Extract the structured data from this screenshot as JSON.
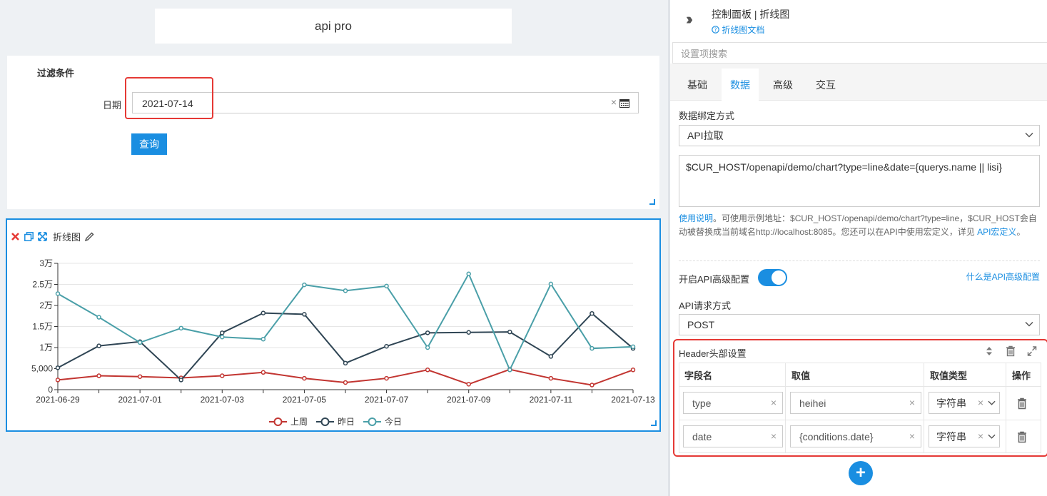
{
  "canvas": {
    "title": "api pro",
    "filter": {
      "title": "过滤条件",
      "date_label": "日期",
      "date_value": "2021-07-14",
      "clear_glyph": "×",
      "query_label": "查询"
    },
    "chart": {
      "toolbar_label": "折线图",
      "toolbar_icons": [
        "close-icon",
        "copy-icon",
        "expand-icon",
        "edit-icon"
      ]
    }
  },
  "chart_data": {
    "type": "line",
    "x": [
      "2021-06-29",
      "2021-06-30",
      "2021-07-01",
      "2021-07-02",
      "2021-07-03",
      "2021-07-04",
      "2021-07-05",
      "2021-07-06",
      "2021-07-07",
      "2021-07-08",
      "2021-07-09",
      "2021-07-10",
      "2021-07-11",
      "2021-07-12",
      "2021-07-13"
    ],
    "x_tick_labels": [
      "2021-06-29",
      "2021-07-01",
      "2021-07-03",
      "2021-07-05",
      "2021-07-07",
      "2021-07-09",
      "2021-07-11",
      "2021-07-13"
    ],
    "y_tick_values": [
      0,
      5000,
      10000,
      15000,
      20000,
      25000,
      30000
    ],
    "y_tick_labels": [
      "0",
      "5,000",
      "1万",
      "1.5万",
      "2万",
      "2.5万",
      "3万"
    ],
    "ylim": [
      0,
      30000
    ],
    "grid": "horizontal",
    "legend_position": "bottom-center",
    "series": [
      {
        "name": "上周",
        "color": "#c23531",
        "values": [
          2300,
          3300,
          3100,
          2800,
          3300,
          4100,
          2700,
          1700,
          2700,
          4700,
          1300,
          4800,
          2700,
          1100,
          4700
        ]
      },
      {
        "name": "昨日",
        "color": "#2f4554",
        "values": [
          5200,
          10400,
          11400,
          2300,
          13500,
          18200,
          17900,
          6300,
          10300,
          13500,
          13600,
          13700,
          7900,
          18100,
          9800
        ]
      },
      {
        "name": "今日",
        "color": "#4a9fa8",
        "values": [
          22800,
          17200,
          11200,
          14600,
          12500,
          12000,
          24900,
          23500,
          24600,
          10000,
          27500,
          4700,
          25100,
          9800,
          10200
        ]
      }
    ]
  },
  "panel": {
    "title": "控制面板 | 折线图",
    "doc_link": "折线图文档",
    "search_placeholder": "设置项搜索",
    "tabs": [
      "基础",
      "数据",
      "高级",
      "交互"
    ],
    "active_tab": "数据",
    "bind_label": "数据绑定方式",
    "bind_value": "API拉取",
    "api_url": "$CUR_HOST/openapi/demo/chart?type=line&date={querys.name || lisi}",
    "help_link": "使用说明",
    "help_text": "。可使用示例地址：$CUR_HOST/openapi/demo/chart?type=line，$CUR_HOST会自动被替换成当前域名http://localhost:8085。您还可以在API中使用宏定义，详见 ",
    "help_link2": "API宏定义",
    "help_end": "。",
    "advanced_label": "开启API高级配置",
    "advanced_on": true,
    "advanced_link": "什么是API高级配置",
    "method_label": "API请求方式",
    "method_value": "POST",
    "header_title": "Header头部设置",
    "header_columns": [
      "字段名",
      "取值",
      "取值类型",
      "操作"
    ],
    "header_rows": [
      {
        "name": "type",
        "value": "heihei",
        "type": "字符串"
      },
      {
        "name": "date",
        "value": "{conditions.date}",
        "type": "字符串"
      }
    ],
    "clear_glyph": "×",
    "add_glyph": "+",
    "accent_color": "#1a8ee1",
    "highlight_color": "#e53935"
  }
}
